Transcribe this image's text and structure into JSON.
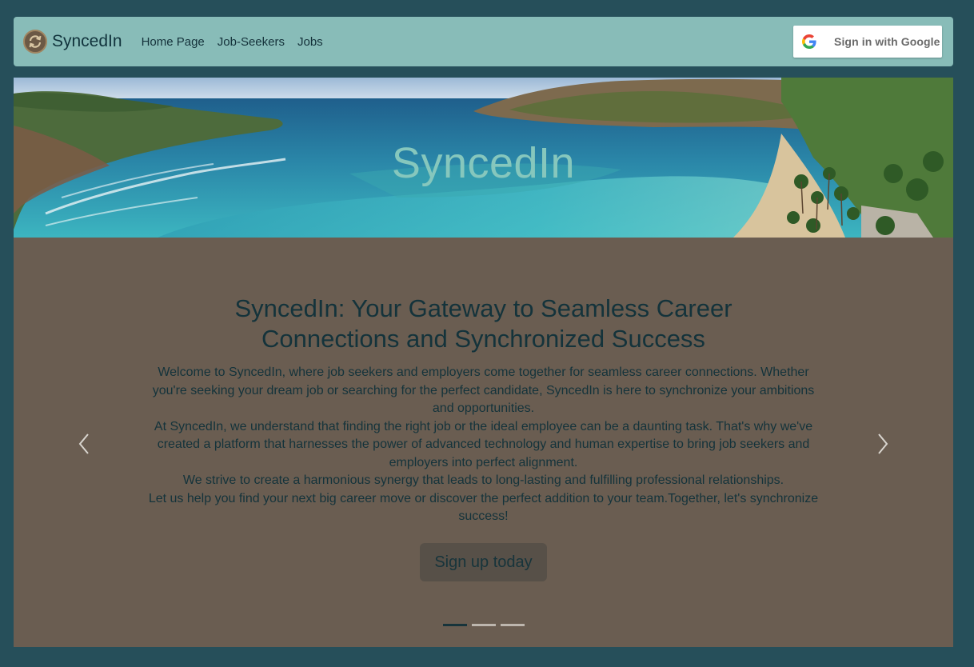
{
  "navbar": {
    "brand": "SyncedIn",
    "links": [
      "Home Page",
      "Job-Seekers",
      "Jobs"
    ],
    "signin_label": "Sign in with Google"
  },
  "hero": {
    "title": "SyncedIn"
  },
  "carousel": {
    "heading": "SyncedIn: Your Gateway to Seamless Career Connections and Synchronized Success",
    "paragraphs": [
      "Welcome to SyncedIn, where job seekers and employers come together for seamless career connections. Whether you're seeking your dream job or searching for the perfect candidate, SyncedIn is here to synchronize your ambitions and opportunities.",
      "At SyncedIn, we understand that finding the right job or the ideal employee can be a daunting task. That's why we've created a platform that harnesses the power of advanced technology and human expertise to bring job seekers and employers into perfect alignment.",
      "We strive to create a harmonious synergy that leads to long-lasting and fulfilling professional relationships.",
      "Let us help you find your next big career move or discover the perfect addition to your team.Together, let's synchronize success!"
    ],
    "cta_label": "Sign up today",
    "slide_count": 3,
    "active_slide": 1
  },
  "colors": {
    "page_bg": "#264f5a",
    "navbar_bg": "#88bcb8",
    "carousel_bg": "#6a5d51",
    "text_dark": "#14333b",
    "hero_title": "#86c7bd",
    "cta_bg": "#575048"
  },
  "icons": {
    "brand": "sync-icon",
    "signin": "google-g-icon",
    "prev": "chevron-left-icon",
    "next": "chevron-right-icon"
  }
}
